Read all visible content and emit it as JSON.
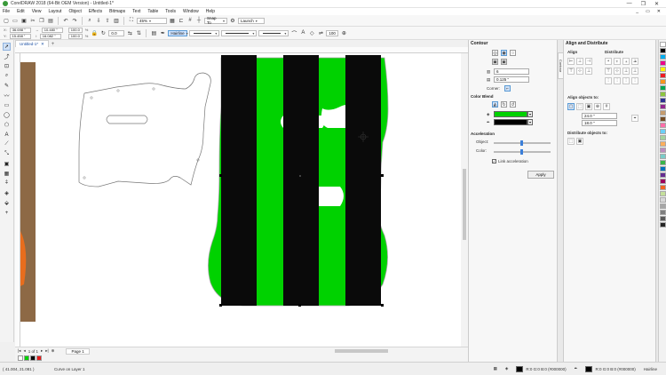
{
  "window": {
    "title": "CorelDRAW 2018 (64-Bit OEM Version) - Untitled-1*",
    "minimize": "—",
    "restore": "❐",
    "close": "✕"
  },
  "menu": {
    "items": [
      "File",
      "Edit",
      "View",
      "Layout",
      "Object",
      "Effects",
      "Bitmaps",
      "Text",
      "Table",
      "Tools",
      "Window",
      "Help"
    ],
    "right": [
      "_",
      "▭",
      "✕"
    ]
  },
  "standard_toolbar": {
    "zoom": "45%",
    "snap_to": "Snap To",
    "launch": "Launch"
  },
  "property_bar": {
    "x": "36.698 \"",
    "y": "15.458 \"",
    "width": "10.480 \"",
    "height": "16.082 \"",
    "scale_w": "100.0",
    "scale_h": "100.0",
    "pct": "%",
    "angle": "0.0",
    "outline_width": "Hairline",
    "outline_scale": "100"
  },
  "document": {
    "tab": "Untitled-1*",
    "tab_close": "✕",
    "page_tab": "Page 1",
    "page_count": "1 of 1"
  },
  "status": {
    "coords": "( 41.004, 21.081 )",
    "info": "Curve on Layer 1",
    "fill_label": "R:0 G:0 B:0 (#000000)",
    "outline_label": "R:0 G:0 B:0 (#000000)",
    "outline_width": "Hairline"
  },
  "contour_panel": {
    "title": "Contour",
    "steps": "6",
    "offset": "0.125 \"",
    "corners_label": "Corner:",
    "color_blend_label": "Color Blend",
    "acceleration_label": "Acceleration",
    "object_label": "Object:",
    "color_label": "Color:",
    "link_label": "Link acceleration",
    "apply_label": "Apply",
    "fill_color": "#00d200",
    "outline_color": "#000000"
  },
  "align_panel": {
    "title": "Align and Distribute",
    "align_label": "Align",
    "distribute_label": "Distribute",
    "align_objects_to": "Align objects to:",
    "x_val": "24.0 \"",
    "y_val": "18.0 \"",
    "distribute_objects_to": "Distribute objects to:"
  },
  "side_tabs": {
    "contour_tab": "Contour",
    "align_tab": "Align and Distribute",
    "hints_tab": "Hints",
    "props_tab": "Object Properties"
  },
  "colors": {
    "green": "#00d200",
    "black": "#0a0a0a",
    "accent": "#3b7fd9"
  }
}
